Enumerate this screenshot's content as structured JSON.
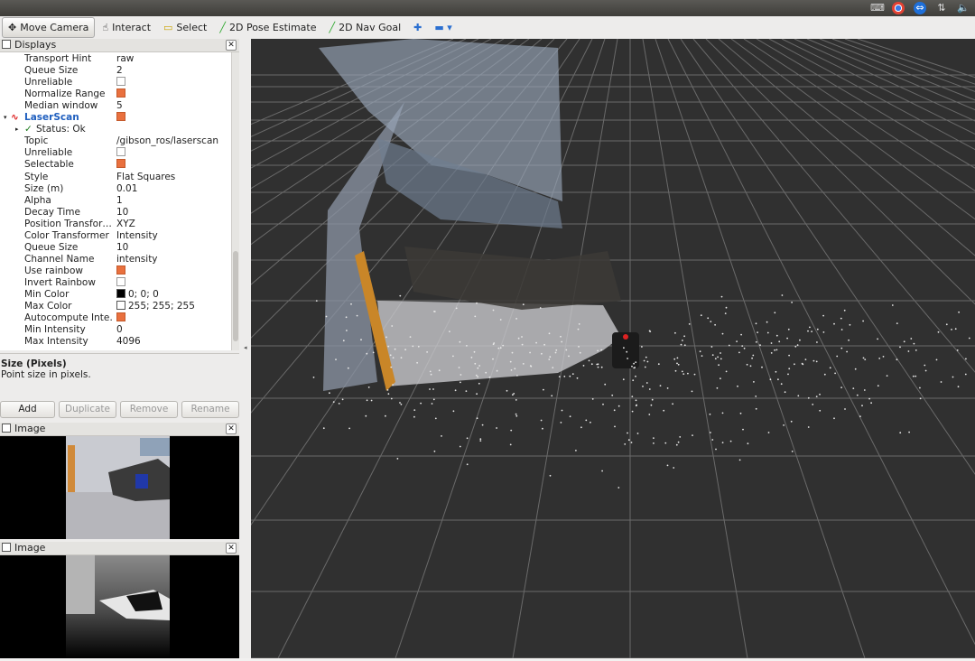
{
  "toolbar": {
    "tools": [
      {
        "label": "Move Camera",
        "icon": "move-camera-icon",
        "glyph": "✥",
        "active": true
      },
      {
        "label": "Interact",
        "icon": "interact-icon",
        "glyph": "☝"
      },
      {
        "label": "Select",
        "icon": "select-icon",
        "glyph": "▭"
      },
      {
        "label": "2D Pose Estimate",
        "icon": "pose-estimate-icon",
        "glyph": "╱"
      },
      {
        "label": "2D Nav Goal",
        "icon": "nav-goal-icon",
        "glyph": "╱"
      }
    ]
  },
  "displays": {
    "title": "Displays",
    "rows": [
      {
        "label": "Transport Hint",
        "value": "raw"
      },
      {
        "label": "Queue Size",
        "value": "2"
      },
      {
        "label": "Unreliable",
        "check": false
      },
      {
        "label": "Normalize Range",
        "check": true
      },
      {
        "label": "Median window",
        "value": "5"
      },
      {
        "label": "LaserScan",
        "check": true,
        "header": true
      },
      {
        "label": "Status: Ok",
        "status": true
      },
      {
        "label": "Topic",
        "value": "/gibson_ros/laserscan"
      },
      {
        "label": "Unreliable",
        "check": false
      },
      {
        "label": "Selectable",
        "check": true
      },
      {
        "label": "Style",
        "value": "Flat Squares"
      },
      {
        "label": "Size (m)",
        "value": "0.01"
      },
      {
        "label": "Alpha",
        "value": "1"
      },
      {
        "label": "Decay Time",
        "value": "10"
      },
      {
        "label": "Position Transfor…",
        "value": "XYZ"
      },
      {
        "label": "Color Transformer",
        "value": "Intensity"
      },
      {
        "label": "Queue Size",
        "value": "10"
      },
      {
        "label": "Channel Name",
        "value": "intensity"
      },
      {
        "label": "Use rainbow",
        "check": true
      },
      {
        "label": "Invert Rainbow",
        "check": false
      },
      {
        "label": "Min Color",
        "value": "0; 0; 0",
        "swatch": "#000000"
      },
      {
        "label": "Max Color",
        "value": "255; 255; 255",
        "swatch": "#ffffff"
      },
      {
        "label": "Autocompute Inte…",
        "check": true
      },
      {
        "label": "Min Intensity",
        "value": "0"
      },
      {
        "label": "Max Intensity",
        "value": "4096"
      }
    ]
  },
  "description": {
    "title": "Size (Pixels)",
    "text": "Point size in pixels."
  },
  "buttons": {
    "add": "Add",
    "duplicate": "Duplicate",
    "remove": "Remove",
    "rename": "Rename"
  },
  "image_panel_1": {
    "title": "Image"
  },
  "image_panel_2": {
    "title": "Image"
  },
  "colors": {
    "accent": "#e9703e",
    "viewport_bg": "#303030",
    "grid_line": "#6a6a6a",
    "header_link": "#1f5fbf"
  }
}
